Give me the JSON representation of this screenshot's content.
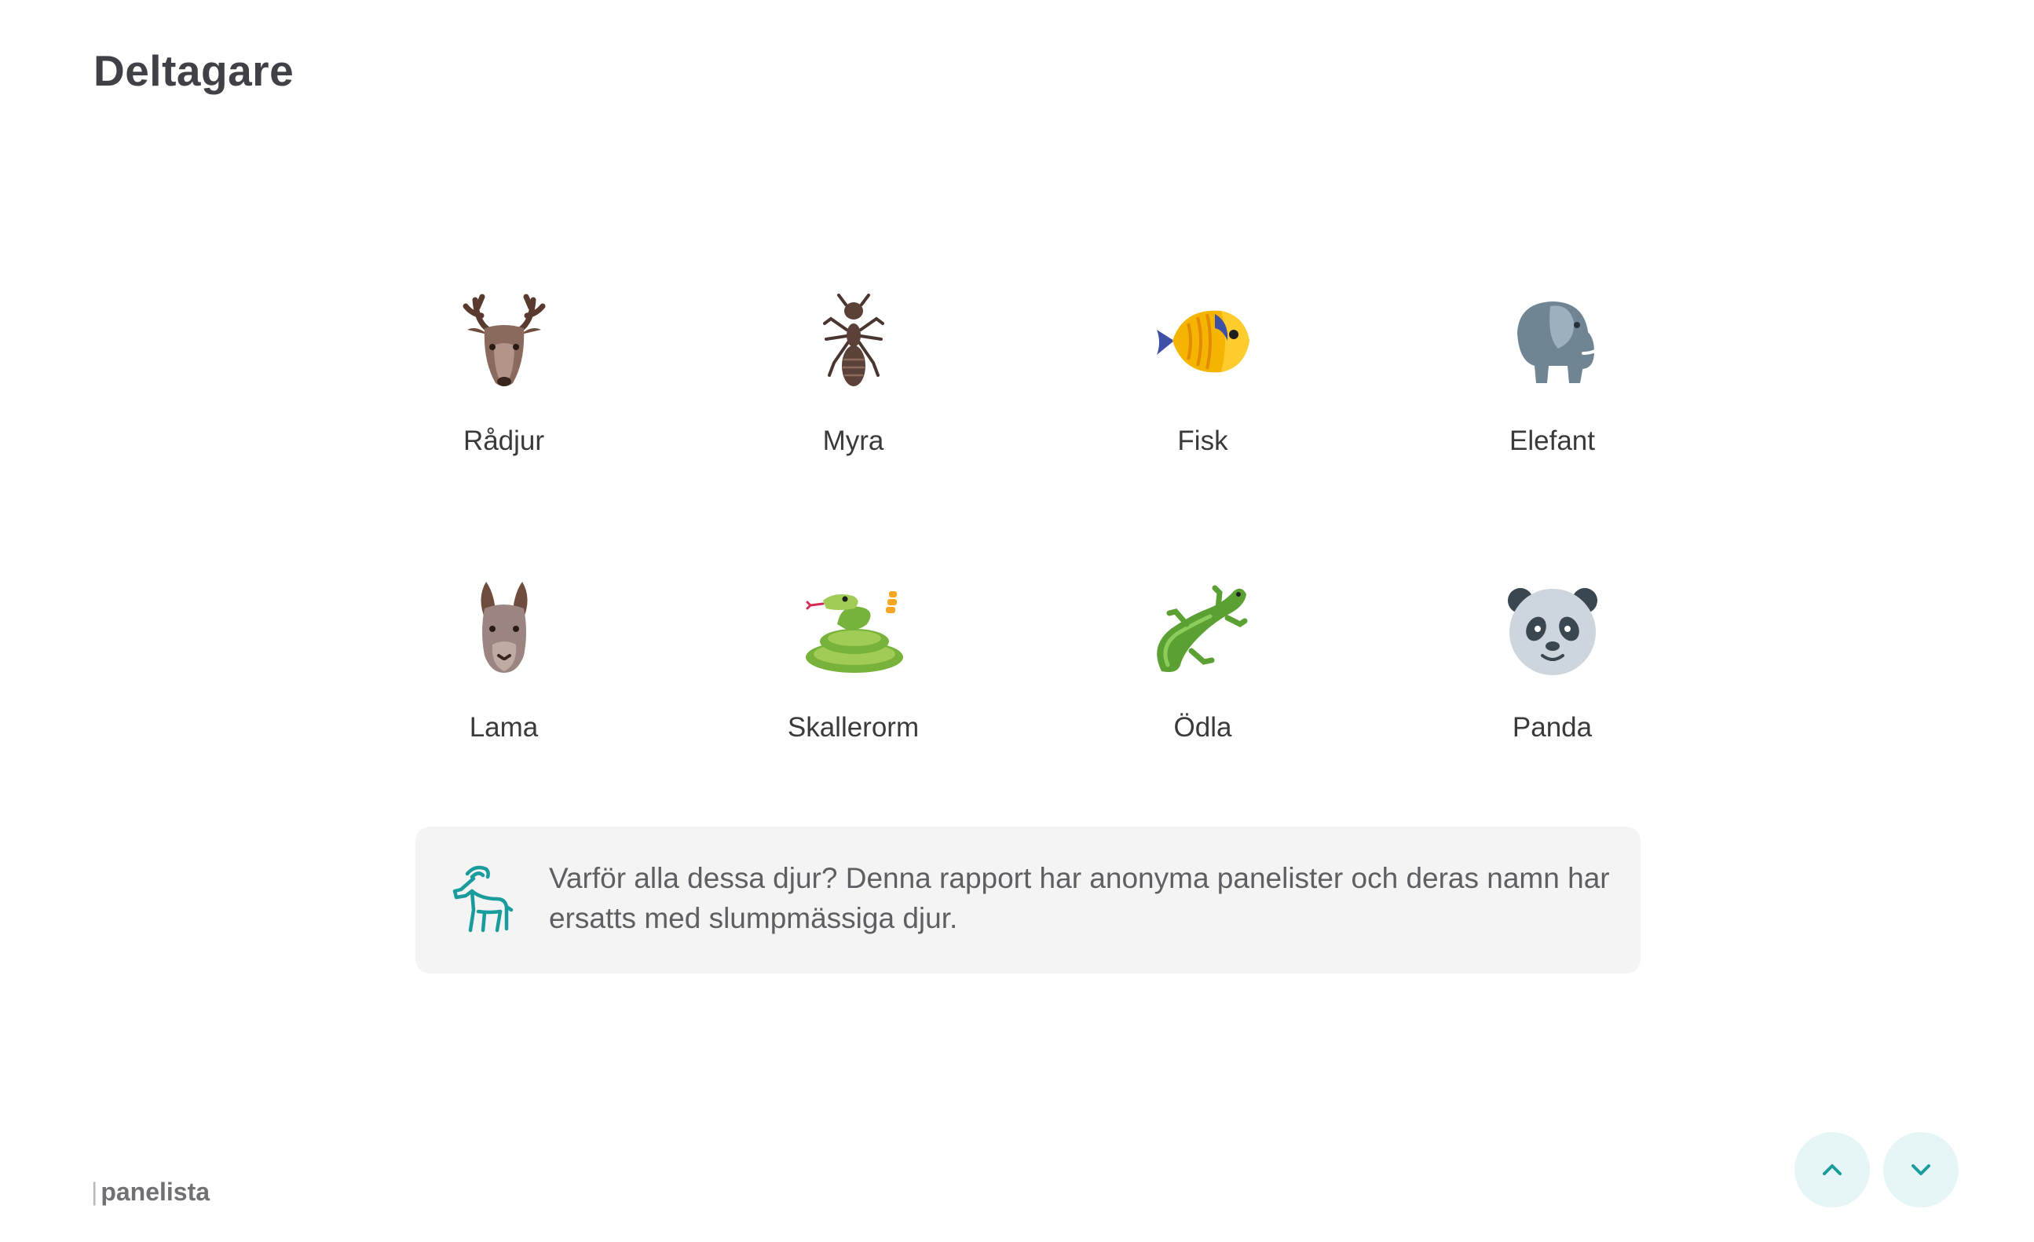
{
  "page": {
    "title": "Deltagare"
  },
  "participants": [
    {
      "label": "Rådjur",
      "icon": "deer-icon"
    },
    {
      "label": "Myra",
      "icon": "ant-icon"
    },
    {
      "label": "Fisk",
      "icon": "fish-icon"
    },
    {
      "label": "Elefant",
      "icon": "elephant-icon"
    },
    {
      "label": "Lama",
      "icon": "llama-icon"
    },
    {
      "label": "Skallerorm",
      "icon": "rattlesnake-icon"
    },
    {
      "label": "Ödla",
      "icon": "lizard-icon"
    },
    {
      "label": "Panda",
      "icon": "panda-icon"
    }
  ],
  "info": {
    "icon": "goat-icon",
    "text": "Varför alla dessa djur? Denna rapport har anonyma panelister och deras namn har ersatts med slumpmässiga djur."
  },
  "footer": {
    "brand": "panelista",
    "brand_prefix": "|"
  },
  "nav": {
    "up_icon": "chevron-up-icon",
    "down_icon": "chevron-down-icon",
    "accent": "#1a9c9c",
    "button_bg": "#e6f5f5"
  }
}
